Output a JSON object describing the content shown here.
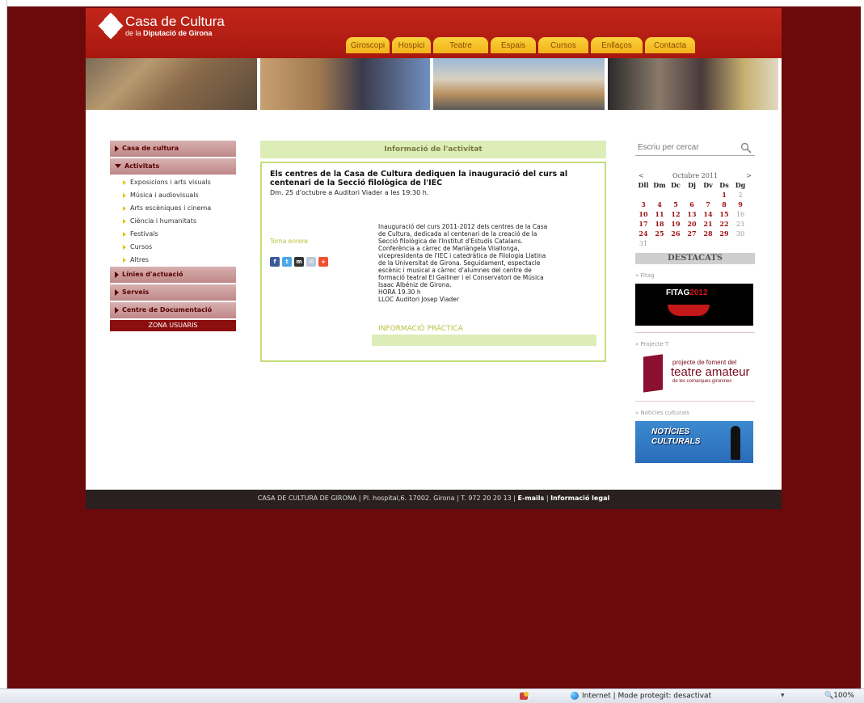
{
  "header": {
    "logo_title": "Casa de Cultura",
    "logo_sub_prefix": "de la",
    "logo_sub_bold": "Diputació de Girona",
    "nav": [
      {
        "label": "Giroscopi"
      },
      {
        "label": "Hospici"
      },
      {
        "label": "Teatre"
      },
      {
        "label": "Espais"
      },
      {
        "label": "Cursos"
      },
      {
        "label": "Enllaços"
      },
      {
        "label": "Contacta"
      }
    ]
  },
  "sidebar": {
    "items": [
      {
        "label": "Casa de cultura"
      },
      {
        "label": "Activitats"
      },
      {
        "label": "Línies d'actuació"
      },
      {
        "label": "Serveis"
      },
      {
        "label": "Centre de Documentació"
      }
    ],
    "sub_items": [
      {
        "label": "Exposicions i arts visuals"
      },
      {
        "label": "Música i audiovisuals"
      },
      {
        "label": "Arts escèniques i cinema"
      },
      {
        "label": "Ciència i humanitats"
      },
      {
        "label": "Festivals"
      },
      {
        "label": "Cursos"
      },
      {
        "label": "Altres"
      }
    ],
    "zone_label": "ZONA USUARIS"
  },
  "main": {
    "section_title": "Informació de l'activitat",
    "title": "Els centres de la Casa de Cultura dediquen la inauguració del curs al centenari de la Secció filològica de l'IEC",
    "date": "Dm. 25 d'octubre a Auditori Viader a les 19:30 h.",
    "back_link": "Torna enrere",
    "description_lines": [
      "Inauguració del curs 2011-2012 dels centres de la Casa",
      "de Cultura, dedicada al centenari de la creació de la",
      "Secció filològica de l'Institut d'Estudis Catalans.",
      "Conferència a càrrec de Mariàngela Vilallonga,",
      "vicepresidenta de l'IEC i catedràtica de Filologia Llatina",
      "de la Universitat de Girona. Seguidament, espectacle",
      "escènic i musical a càrrec d'alumnes del centre de",
      "formació teatral El Galliner i el Conservatori de Música",
      "Isaac Albéniz de Girona.",
      "HORA 19.30 h",
      "LLOC Auditori Josep Viader"
    ],
    "info_label": "INFORMACIÓ PRÀCTICA",
    "share": [
      {
        "icon": "facebook-icon",
        "glyph": "f",
        "color": "#3b5998"
      },
      {
        "icon": "twitter-icon",
        "glyph": "t",
        "color": "#4aa8e8"
      },
      {
        "icon": "myspace-icon",
        "glyph": "m",
        "color": "#333333"
      },
      {
        "icon": "email-icon",
        "glyph": "✉",
        "color": "#b8c8d8"
      },
      {
        "icon": "addthis-icon",
        "glyph": "+",
        "color": "#f05030"
      }
    ]
  },
  "right": {
    "search_placeholder": "Escriu per cercar",
    "calendar": {
      "prev": "<",
      "month": "Octubre 2011",
      "next": ">",
      "days": [
        "Dll",
        "Dm",
        "Dc",
        "Dj",
        "Dv",
        "Ds",
        "Dg"
      ]
    },
    "destacats": "DESTACATS",
    "fitag_label": "» Fitag",
    "fitag_name": "FITAG",
    "fitag_year": "2012",
    "projecte_label": "» Projecte T",
    "projecte_line1": "projecte de foment del",
    "projecte_line2": "teatre amateur",
    "projecte_line3": "de les comarques gironines",
    "noticies_label": "» Notícies culturals",
    "noticies_line1": "NOTÍCIES",
    "noticies_line2": "CULTURALS"
  },
  "footer": {
    "text": "CASA DE CULTURA DE GIRONA | Pl. hospital,6. 17002. Girona | T. 972 20 20 13 | ",
    "emails": "E-mails",
    "sep": " | ",
    "legal": "Informació legal"
  },
  "statusbar": {
    "zone": "Internet | Mode protegit: desactivat",
    "zoom": "100%",
    "zoom_icon": "🔍",
    "extra": "▾"
  },
  "colors": {
    "background": "#6b0a0a",
    "header_red": "#b81f14",
    "tab_yellow": "#f5c12a",
    "accent_green": "#c5dd7a"
  }
}
